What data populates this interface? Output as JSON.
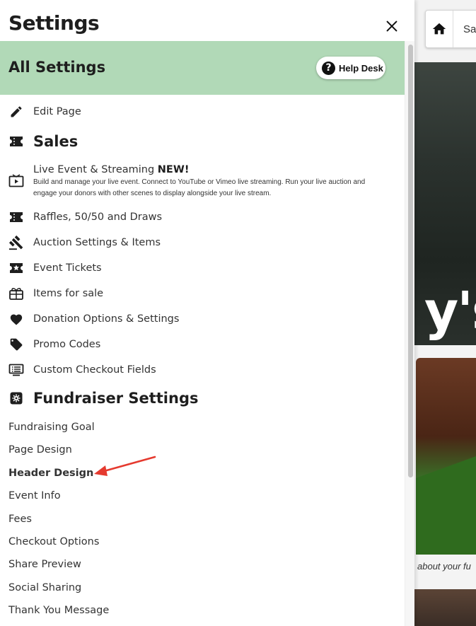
{
  "panel": {
    "title": "Settings",
    "banner_title": "All Settings",
    "help_desk_label": "Help Desk"
  },
  "menu": {
    "edit_page": "Edit Page",
    "sales_section": "Sales",
    "live_event": {
      "title": "Live Event & Streaming",
      "badge": "NEW!",
      "description": "Build and manage your live event. Connect to YouTube or Vimeo live streaming. Run your live auction and engage your donors with other scenes to display alongside your live stream."
    },
    "sales_items": [
      {
        "label": "Raffles, 50/50 and Draws",
        "icon": "ticket-icon"
      },
      {
        "label": "Auction Settings & Items",
        "icon": "gavel-icon"
      },
      {
        "label": "Event Tickets",
        "icon": "star-ticket-icon"
      },
      {
        "label": "Items for sale",
        "icon": "gift-icon"
      },
      {
        "label": "Donation Options & Settings",
        "icon": "heart-icon"
      },
      {
        "label": "Promo Codes",
        "icon": "tag-icon"
      },
      {
        "label": "Custom Checkout Fields",
        "icon": "form-icon"
      }
    ],
    "fundraiser_section": "Fundraiser Settings",
    "fundraiser_links": [
      "Fundraising Goal",
      "Page Design",
      "Header Design",
      "Event Info",
      "Fees",
      "Checkout Options",
      "Share Preview",
      "Social Sharing",
      "Thank You Message"
    ]
  },
  "preview": {
    "toolbar_save_text": "Save",
    "hero_text": "y's",
    "caption": "about your fu"
  },
  "colors": {
    "banner": "#b1d9b7",
    "annotation_arrow": "#e53a2f"
  }
}
